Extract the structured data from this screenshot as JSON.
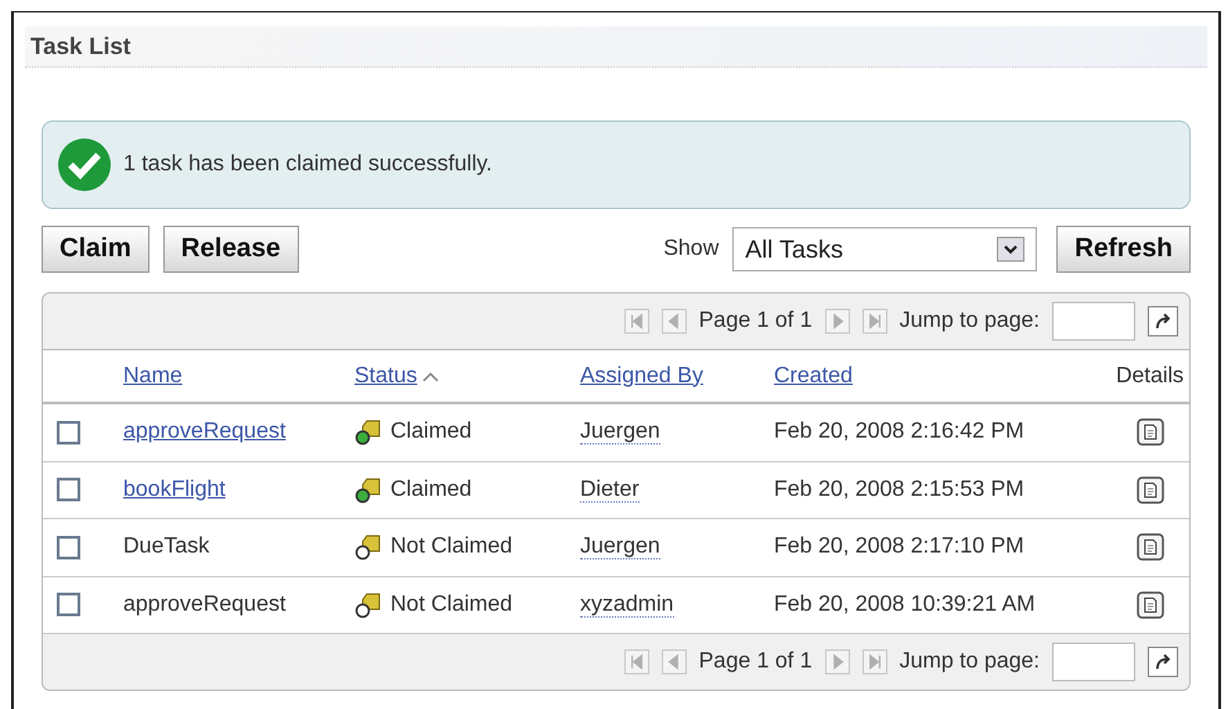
{
  "panel": {
    "title": "Task List"
  },
  "message": {
    "text": "1 task has been claimed successfully."
  },
  "actions": [
    "Claim",
    "Release"
  ],
  "filter": {
    "label": "Show",
    "value": "All Tasks"
  },
  "refresh": "Refresh",
  "pager_top": {
    "page": "Page 1 of 1",
    "jump_label": "Jump to page:"
  },
  "table": {
    "columns": [
      {
        "label": "Name",
        "sortable": true,
        "sorted": false
      },
      {
        "label": "Status",
        "sortable": true,
        "sorted": true
      },
      {
        "label": "Assigned By",
        "sortable": true,
        "sorted": false
      },
      {
        "label": "Created",
        "sortable": true,
        "sorted": false
      },
      {
        "label": "Details",
        "sortable": false,
        "sorted": false
      }
    ],
    "rows": [
      {
        "checked": false,
        "name": "approveRequest",
        "name_link": true,
        "status": "Claimed",
        "claimed": true,
        "assigned_by": "Juergen",
        "created": "Feb 20, 2008 2:16:42 PM"
      },
      {
        "checked": false,
        "name": "bookFlight",
        "name_link": true,
        "status": "Claimed",
        "claimed": true,
        "assigned_by": "Dieter",
        "created": "Feb 20, 2008 2:15:53 PM"
      },
      {
        "checked": false,
        "name": "DueTask",
        "name_link": false,
        "status": "Not Claimed",
        "claimed": false,
        "assigned_by": "Juergen",
        "created": "Feb 20, 2008 2:17:10 PM"
      },
      {
        "checked": false,
        "name": "approveRequest",
        "name_link": false,
        "status": "Not Claimed",
        "claimed": false,
        "assigned_by": "xyzadmin",
        "created": "Feb 20, 2008 10:39:21 AM"
      }
    ]
  },
  "pager_bottom": {
    "page": "Page 1 of 1",
    "jump_label": "Jump to page:"
  }
}
